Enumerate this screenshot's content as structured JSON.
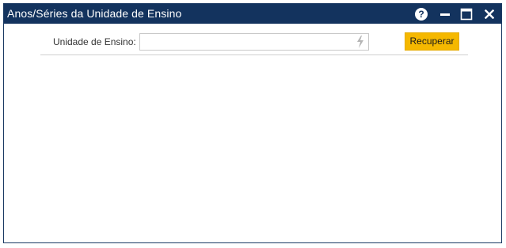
{
  "window": {
    "title": "Anos/Séries da Unidade de Ensino",
    "controls": {
      "help_icon": "help-icon",
      "minimize_icon": "minimize-icon",
      "maximize_icon": "maximize-icon",
      "close_icon": "close-icon",
      "help_glyph": "?"
    },
    "titlebar_color": "#13335e"
  },
  "filter": {
    "label": "Unidade de Ensino:",
    "value": "",
    "icon": "bolt-icon"
  },
  "actions": {
    "recuperar_label": "Recuperar",
    "accent_color": "#f5b800"
  }
}
